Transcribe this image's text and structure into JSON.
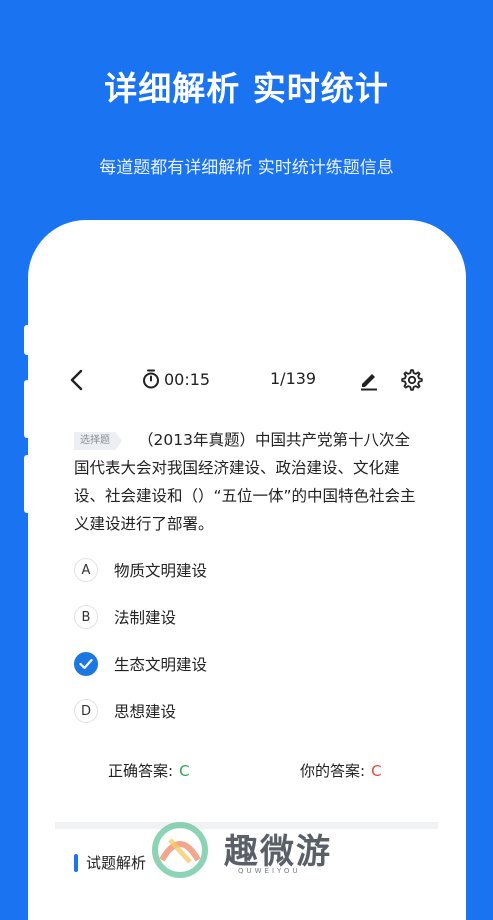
{
  "promo": {
    "title": "详细解析 实时统计",
    "subtitle": "每道题都有详细解析 实时统计练题信息"
  },
  "topbar": {
    "timer": "00:15",
    "progress": "1/139"
  },
  "question": {
    "type_tag": "选择题",
    "text": "（2013年真题）中国共产党第十八次全国代表大会对我国经济建设、政治建设、文化建设、社会建设和（）“五位一体”的中国特色社会主义建设进行了部署。"
  },
  "options": [
    {
      "key": "A",
      "text": "物质文明建设",
      "selected": false
    },
    {
      "key": "B",
      "text": "法制建设",
      "selected": false
    },
    {
      "key": "C",
      "text": "生态文明建设",
      "selected": true
    },
    {
      "key": "D",
      "text": "思想建设",
      "selected": false
    }
  ],
  "answers": {
    "correct_label": "正确答案:",
    "correct_value": "C",
    "yours_label": "你的答案:",
    "yours_value": "C"
  },
  "analysis": {
    "label": "试题解析"
  },
  "watermark": {
    "text": "趣微游",
    "sub": "QUWEIYOU"
  },
  "colors": {
    "background": "#1a73f0",
    "accent": "#1a78e0",
    "correct": "#2fa84f",
    "yours": "#e34a3a"
  }
}
